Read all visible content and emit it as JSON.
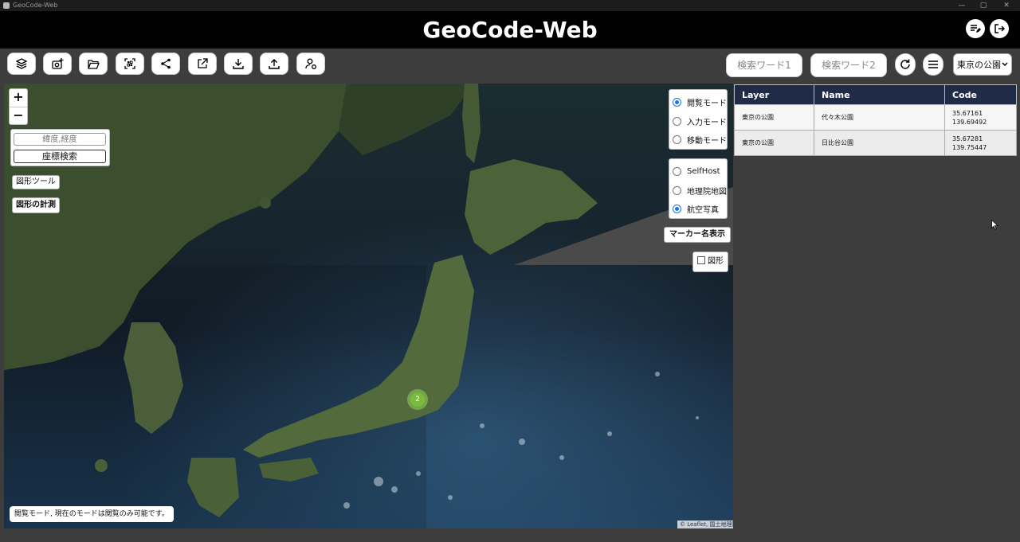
{
  "window": {
    "title": "GeoCode-Web",
    "controls": [
      "—",
      "▢",
      "✕"
    ]
  },
  "header": {
    "title": "GeoCode-Web"
  },
  "toolbar": {
    "buttons": [
      "layers-icon",
      "add-photo-icon",
      "folder-open-icon",
      "qr-scan-icon",
      "share-icon",
      "open-external-icon",
      "download-icon",
      "upload-icon",
      "user-settings-icon"
    ],
    "search1_placeholder": "検索ワード1",
    "search2_placeholder": "検索ワード2",
    "layer_select": {
      "selected": "東京の公園"
    }
  },
  "map": {
    "zoom_in": "+",
    "zoom_out": "−",
    "coord_placeholder": "緯度,経度",
    "coord_search": "座標検索",
    "shape_tool": "図形ツール",
    "shape_measure": "図形の計測",
    "modes": [
      {
        "label": "閲覧モード",
        "checked": true
      },
      {
        "label": "入力モード",
        "checked": false
      },
      {
        "label": "移動モード",
        "checked": false
      }
    ],
    "base_layers": [
      {
        "label": "SelfHost",
        "checked": false
      },
      {
        "label": "地理院地図",
        "checked": false
      },
      {
        "label": "航空写真",
        "checked": true
      }
    ],
    "marker_name_button": "マーカー名表示",
    "shape_checkbox": "図形",
    "cluster_count": "2",
    "status": "閲覧モード, 現在のモードは閲覧のみ可能です。",
    "attribution": "© Leaflet, 国土地理院"
  },
  "table": {
    "headers": [
      "Layer",
      "Name",
      "Code"
    ],
    "rows": [
      {
        "layer": "東京の公園",
        "name": "代々木公園",
        "lat": "35.67161",
        "lng": "139.69492"
      },
      {
        "layer": "東京の公園",
        "name": "日比谷公園",
        "lat": "35.67281",
        "lng": "139.75447"
      }
    ]
  },
  "colors": {
    "header_bg": "#000000",
    "table_header_bg": "#1f2b47",
    "radio_accent": "#1a73e8",
    "cluster": "#78be3c"
  }
}
